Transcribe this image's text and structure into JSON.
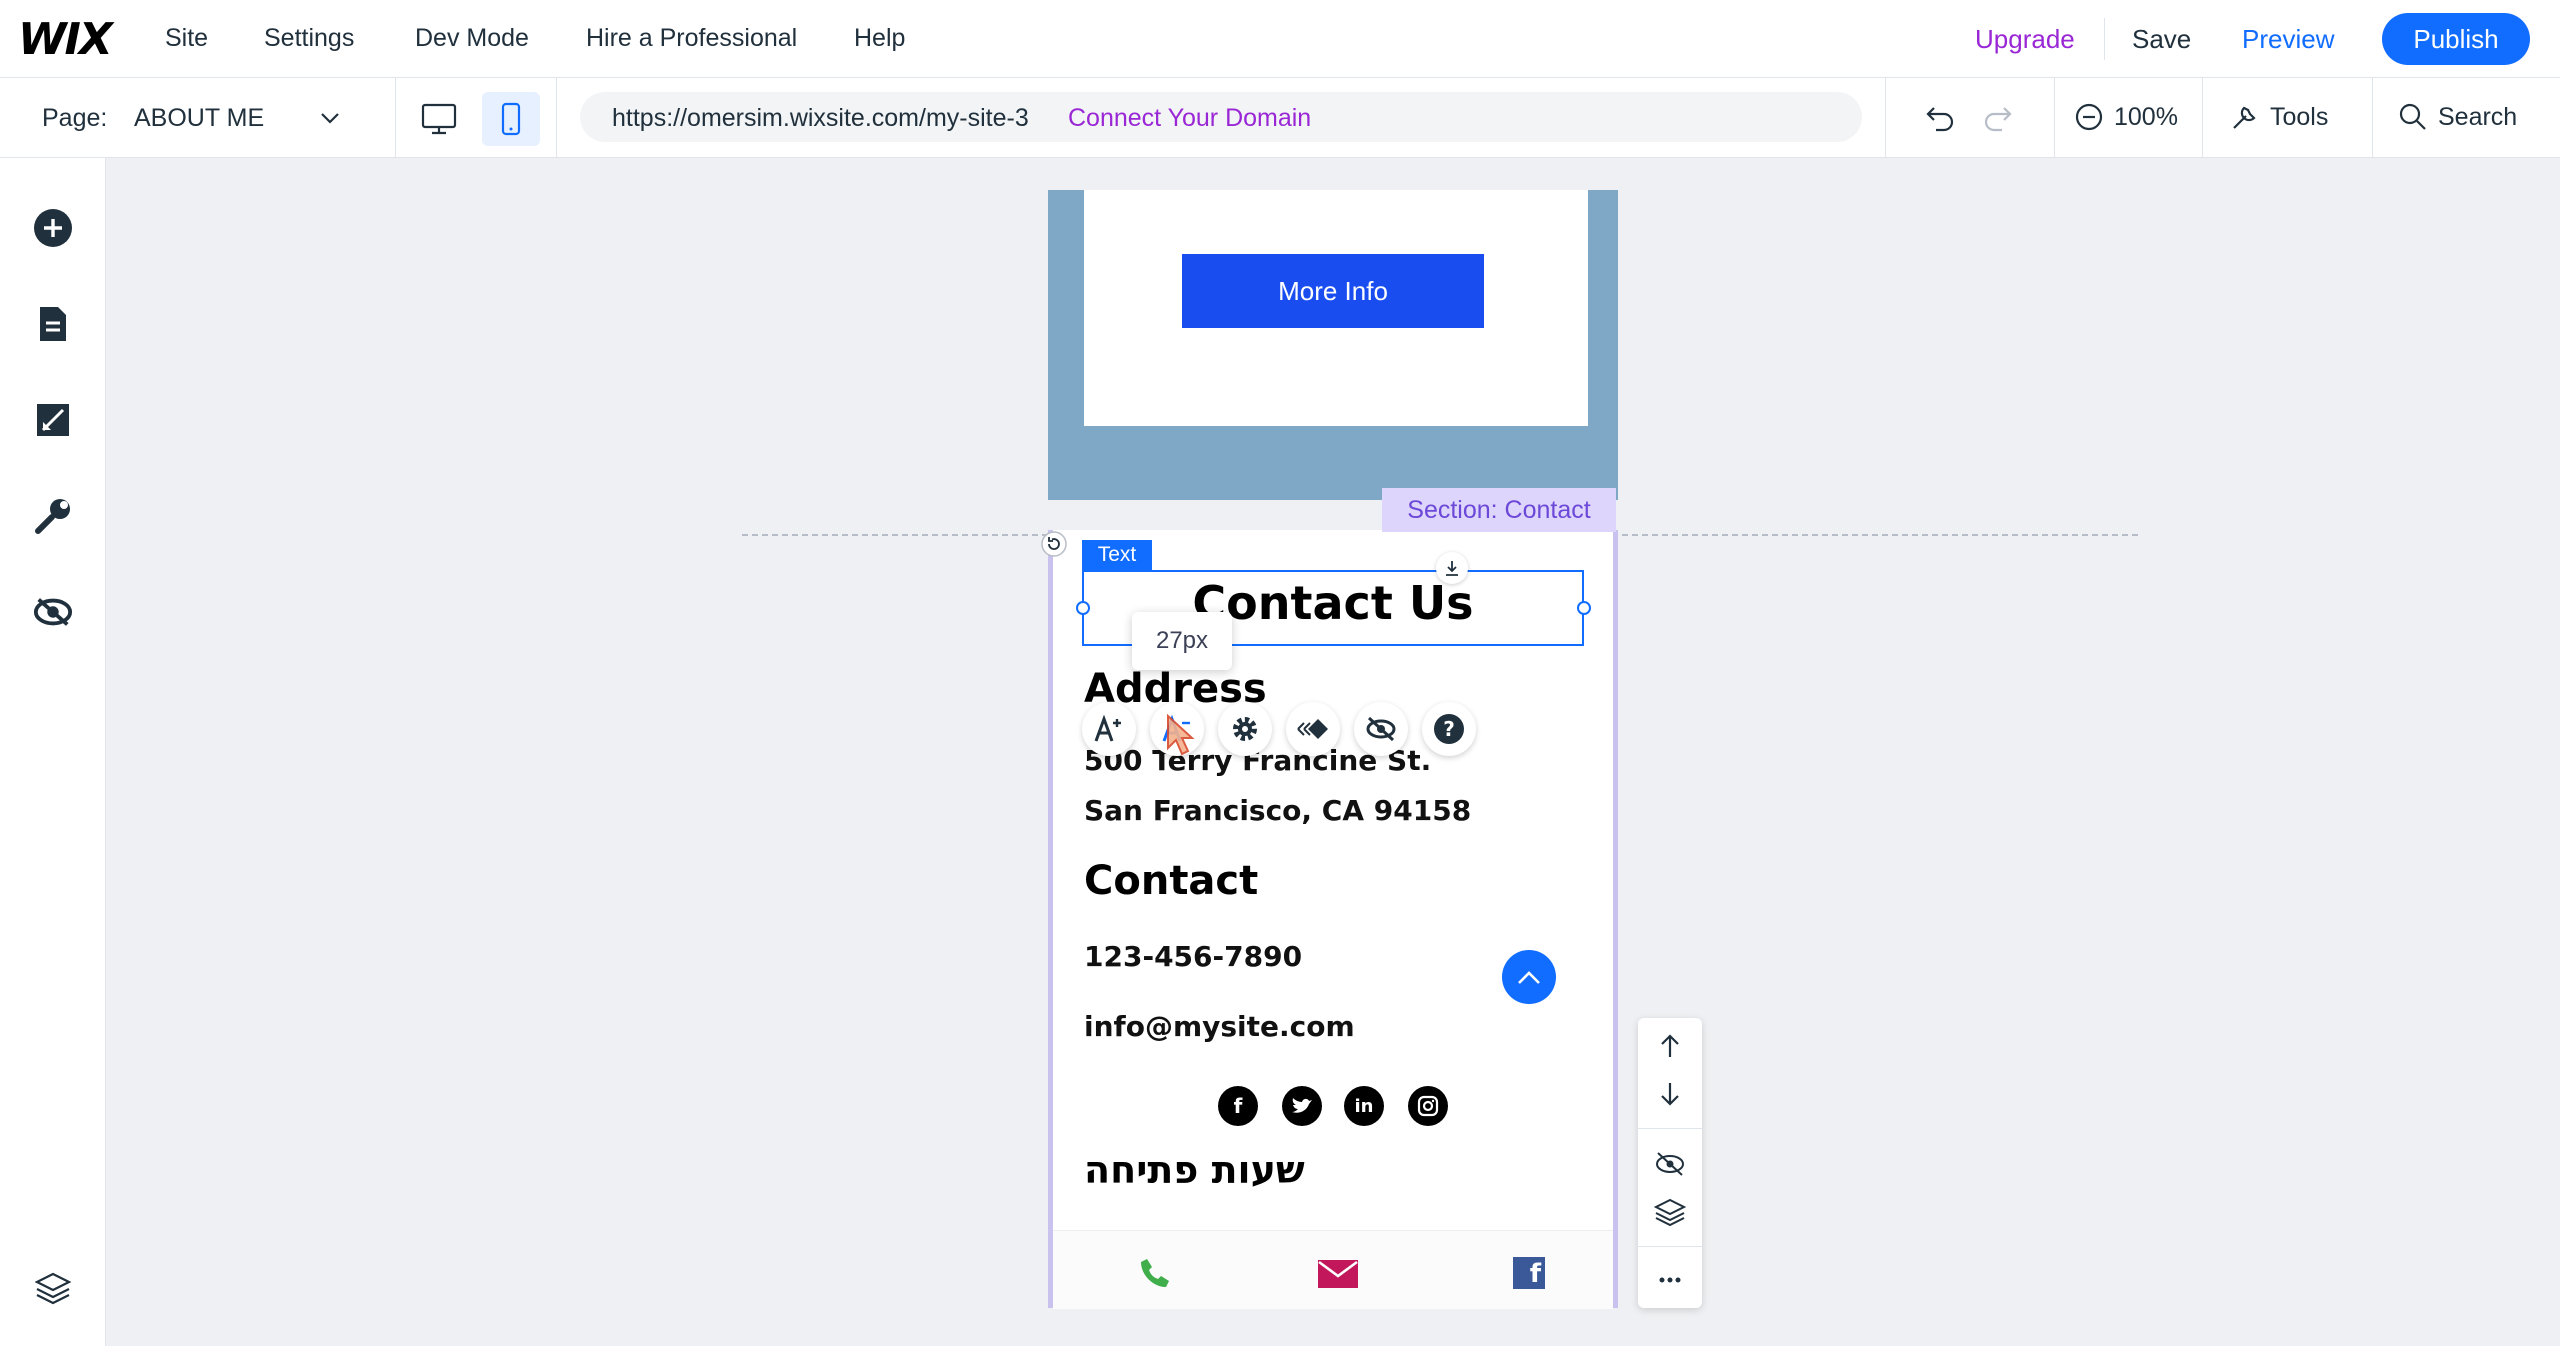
{
  "brand": {
    "logo": "WIX",
    "accent": "#116dff",
    "upgrade_color": "#9a27d5"
  },
  "topbar": {
    "menu": [
      "Site",
      "Settings",
      "Dev Mode",
      "Hire a Professional",
      "Help"
    ],
    "upgrade": "Upgrade",
    "save": "Save",
    "preview": "Preview",
    "publish": "Publish"
  },
  "secondbar": {
    "page_label": "Page:",
    "page_name": "ABOUT ME",
    "url": "https://omersim.wixsite.com/my-site-3",
    "connect_domain": "Connect Your Domain",
    "zoom": "100%",
    "tools": "Tools",
    "search": "Search",
    "active_device": "mobile"
  },
  "sidebar": {
    "items": [
      "add-elements-icon",
      "pages-icon",
      "design-icon",
      "settings-wrench-icon",
      "hidden-elements-icon"
    ],
    "bottom": "layers-icon"
  },
  "canvas": {
    "more_info": "More Info",
    "section_tag": "Section: Contact",
    "selected_tag": "Text",
    "heading": "Contact Us",
    "size_tooltip": "27px",
    "address_heading": "Address",
    "address_line1": "500 Terry Francine St.",
    "address_line2": "San Francisco, CA 94158",
    "contact_heading": "Contact",
    "phone": "123-456-7890",
    "email": "info@mysite.com",
    "social": [
      "facebook-icon",
      "twitter-icon",
      "linkedin-icon",
      "instagram-icon"
    ],
    "hebrew_heading": "שעות פתיחה",
    "bottom_bar": [
      "phone-icon",
      "mail-icon",
      "facebook-icon"
    ]
  }
}
